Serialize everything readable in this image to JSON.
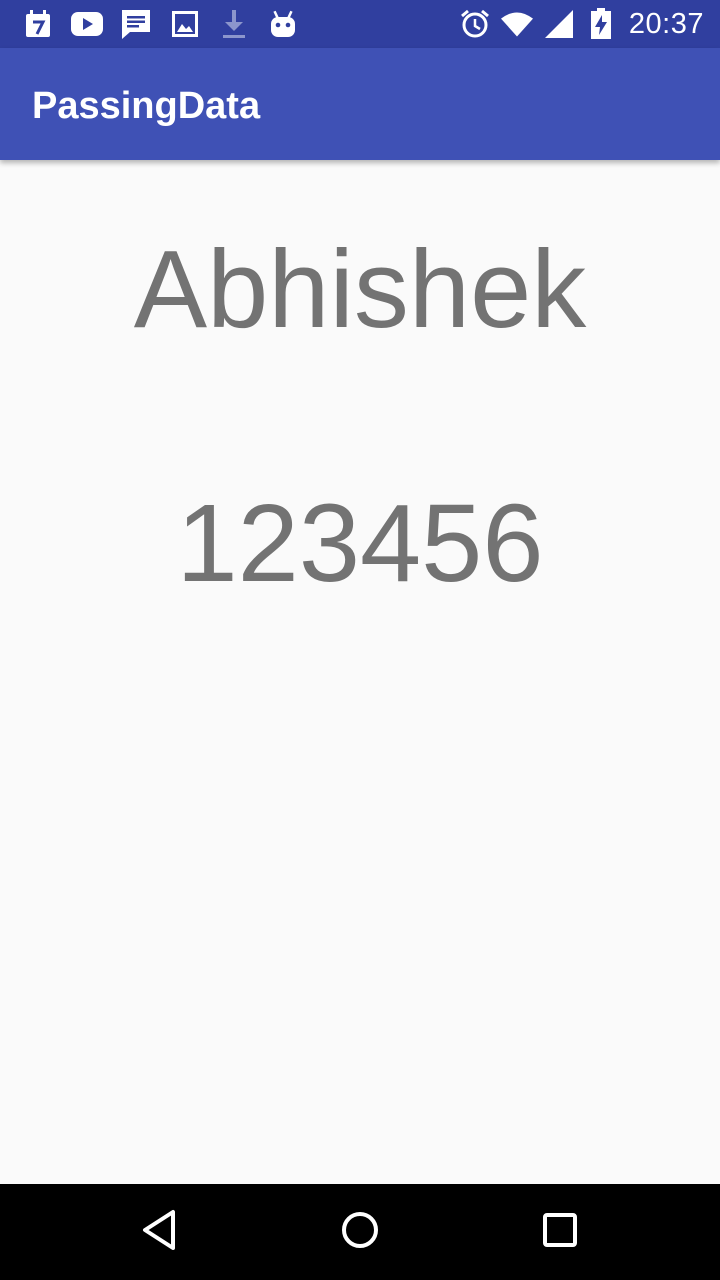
{
  "status_bar": {
    "left_icons": [
      "calendar-icon",
      "youtube-icon",
      "message-icon",
      "image-icon",
      "download-icon",
      "android-icon"
    ],
    "right_icons": [
      "alarm-icon",
      "wifi-icon",
      "signal-icon",
      "battery-icon"
    ],
    "time": "20:37",
    "background_color": "#303f9f"
  },
  "app_bar": {
    "title": "PassingData",
    "background_color": "#3f51b5"
  },
  "content": {
    "name": "Abhishek",
    "number": "123456",
    "text_color": "#737373"
  },
  "nav_bar": {
    "buttons": [
      "back-icon",
      "home-icon",
      "recents-icon"
    ]
  }
}
